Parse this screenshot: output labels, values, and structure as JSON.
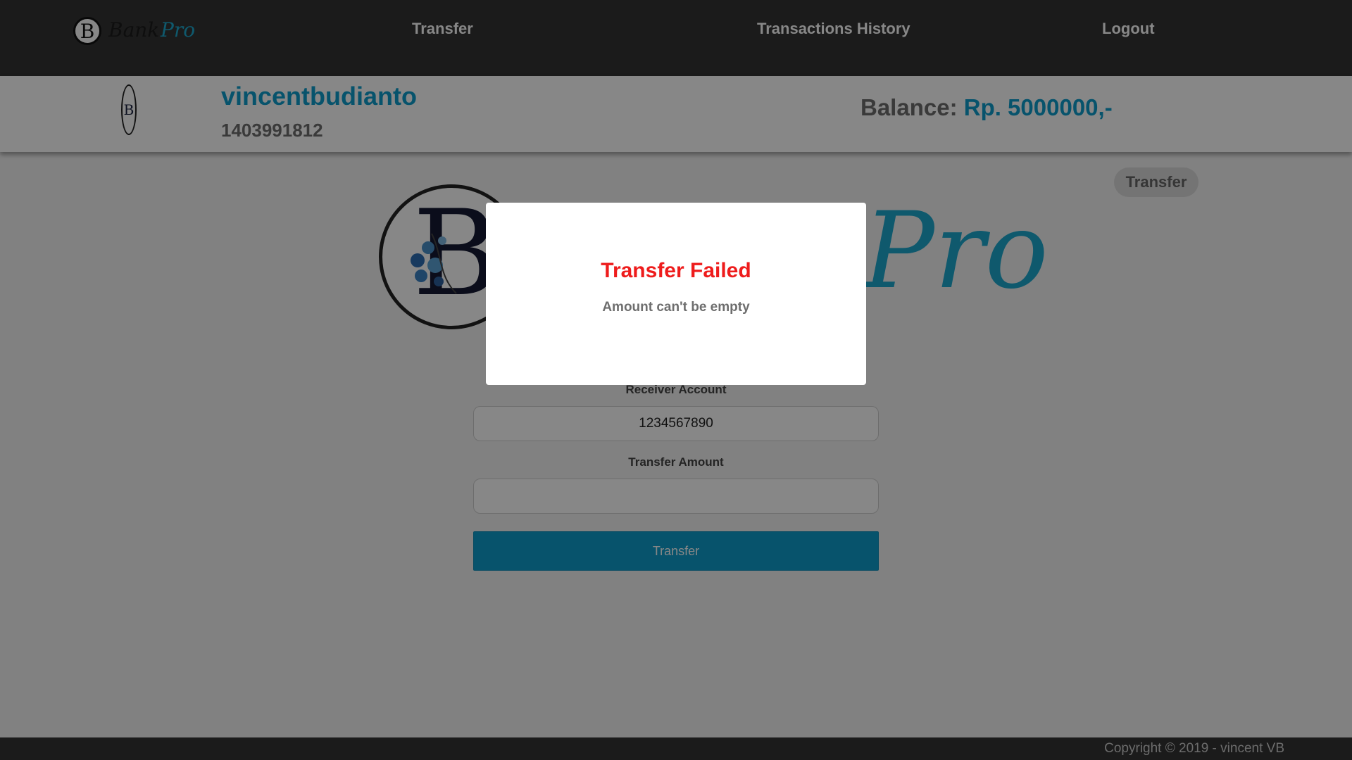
{
  "navbar": {
    "logo": {
      "mark": "B",
      "brand_a": "Bank",
      "brand_b": "Pro"
    },
    "links": [
      "Transfer",
      "Transactions History",
      "Logout"
    ]
  },
  "user": {
    "avatar_mark": "B",
    "username": "vincentbudianto",
    "account_number": "1403991812",
    "balance_label": "Balance: ",
    "balance_value": "Rp. 5000000,-"
  },
  "page": {
    "badge": "Transfer",
    "hero_logo": {
      "mark": "B",
      "script": "Pro"
    }
  },
  "form": {
    "receiver_label": "Receiver Account",
    "receiver_value": "1234567890",
    "amount_label": "Transfer Amount",
    "amount_value": "",
    "submit_label": "Transfer"
  },
  "modal": {
    "title": "Transfer Failed",
    "message": "Amount can't be empty"
  },
  "footer": {
    "copyright": "Copyright © 2019 - vincent VB"
  },
  "colors": {
    "accent": "#0f9ecc",
    "error": "#ee1c1c",
    "navbar": "#333333"
  }
}
